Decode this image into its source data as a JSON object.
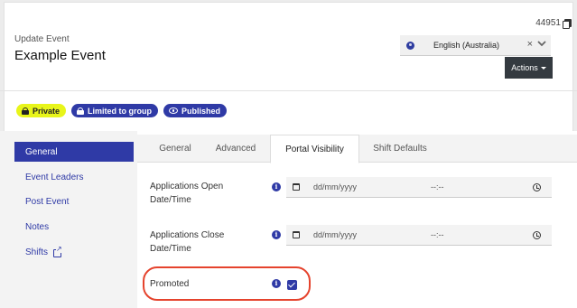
{
  "header": {
    "record_id": "44951",
    "subtitle": "Update Event",
    "title": "Example Event",
    "language": {
      "selected": "English (Australia)",
      "clear_glyph": "×"
    },
    "actions_label": "Actions"
  },
  "badges": [
    {
      "label": "Private",
      "icon": "lock-icon",
      "color": "#e8f51a"
    },
    {
      "label": "Limited to group",
      "icon": "lock-icon",
      "color": "#2f3aa6"
    },
    {
      "label": "Published",
      "icon": "eye-icon",
      "color": "#2f3aa6"
    }
  ],
  "sidebar": {
    "items": [
      {
        "label": "General",
        "active": true
      },
      {
        "label": "Event Leaders",
        "active": false
      },
      {
        "label": "Post Event",
        "active": false
      },
      {
        "label": "Notes",
        "active": false
      },
      {
        "label": "Shifts",
        "active": false,
        "icon": "external-link-icon"
      }
    ]
  },
  "tabs": [
    {
      "label": "General",
      "active": false
    },
    {
      "label": "Advanced",
      "active": false
    },
    {
      "label": "Portal Visibility",
      "active": true
    },
    {
      "label": "Shift Defaults",
      "active": false
    }
  ],
  "form": {
    "info_glyph": "i",
    "applications_open": {
      "label": "Applications Open Date/Time",
      "date_placeholder": "dd/mm/yyyy",
      "time_placeholder": "--:--"
    },
    "applications_close": {
      "label": "Applications Close Date/Time",
      "date_placeholder": "dd/mm/yyyy",
      "time_placeholder": "--:--"
    },
    "promoted": {
      "label": "Promoted",
      "checked": true
    }
  },
  "colors": {
    "accent": "#2f3aa6",
    "private_badge": "#e8f51a",
    "highlight": "#e5432d",
    "actions_button": "#343a40"
  }
}
